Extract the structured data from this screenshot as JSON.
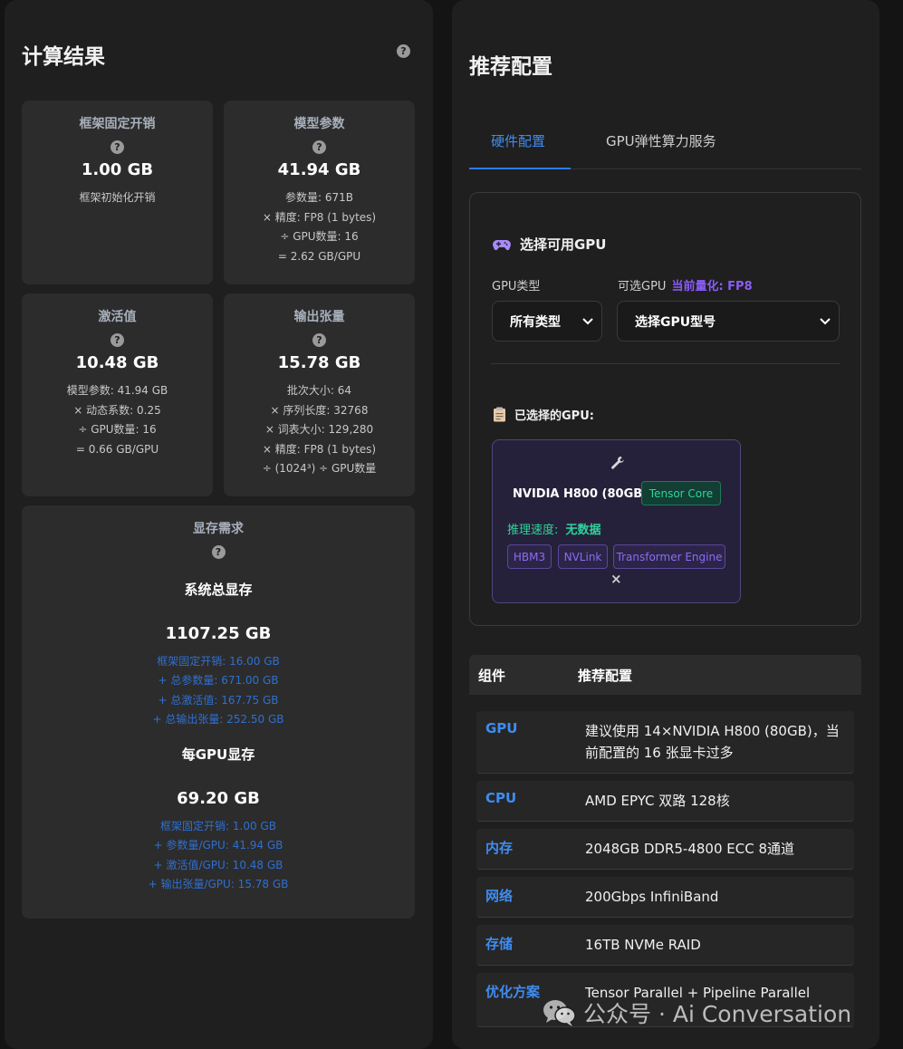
{
  "left": {
    "title": "计算结果",
    "help_icon": "question-circle-icon",
    "cards": {
      "framework": {
        "title": "框架固定开销",
        "value": "1.00 GB",
        "details": [
          "框架初始化开销"
        ]
      },
      "params": {
        "title": "模型参数",
        "value": "41.94 GB",
        "details": [
          "参数量: 671B",
          "× 精度: FP8 (1 bytes)",
          "÷ GPU数量: 16",
          "= 2.62 GB/GPU"
        ]
      },
      "activation": {
        "title": "激活值",
        "value": "10.48 GB",
        "details": [
          "模型参数: 41.94 GB",
          "× 动态系数: 0.25",
          "÷ GPU数量: 16",
          "= 0.66 GB/GPU"
        ]
      },
      "output": {
        "title": "输出张量",
        "value": "15.78 GB",
        "details": [
          "批次大小: 64",
          "× 序列长度: 32768",
          "× 词表大小: 129,280",
          "× 精度: FP8 (1 bytes)",
          "÷ (1024³) ÷ GPU数量"
        ]
      }
    },
    "memory": {
      "title": "显存需求",
      "system_label": "系统总显存",
      "system_total": "1107.25 GB",
      "system_breakdown": [
        "框架固定开销: 16.00 GB",
        "+ 总参数量: 671.00 GB",
        "+ 总激活值: 167.75 GB",
        "+ 总输出张量: 252.50 GB"
      ],
      "per_gpu_label": "每GPU显存",
      "per_gpu_total": "69.20 GB",
      "per_gpu_breakdown": [
        "框架固定开销: 1.00 GB",
        "+ 参数量/GPU: 41.94 GB",
        "+ 激活值/GPU: 10.48 GB",
        "+ 输出张量/GPU: 15.78 GB"
      ]
    }
  },
  "right": {
    "title": "推荐配置",
    "tabs": [
      {
        "label": "硬件配置",
        "active": true
      },
      {
        "label": "GPU弹性算力服务",
        "active": false
      }
    ],
    "select_gpu": {
      "title": "选择可用GPU",
      "title_icon": "gamepad-icon",
      "gpu_type_label": "GPU类型",
      "gpu_type_value": "所有类型",
      "available_label": "可选GPU",
      "quant_label": "当前量化: FP8",
      "available_value": "选择GPU型号"
    },
    "selected": {
      "title": "已选择的GPU:",
      "title_icon": "clipboard-icon",
      "card": {
        "icon": "wrench-icon",
        "name": "NVIDIA H800 (80GB)",
        "tensor_tag": "Tensor Core",
        "speed_label": "推理速度:",
        "speed_value": "无数据",
        "features": [
          "HBM3",
          "NVLink",
          "Transformer Engine"
        ],
        "remove_label": "×"
      }
    },
    "config_table": {
      "headers": [
        "组件",
        "推荐配置"
      ],
      "rows": [
        {
          "key": "GPU",
          "value": "建议使用 14×NVIDIA H800 (80GB)，当前配置的 16 张显卡过多"
        },
        {
          "key": "CPU",
          "value": "AMD EPYC 双路 128核"
        },
        {
          "key": "内存",
          "value": "2048GB DDR5-4800 ECC 8通道"
        },
        {
          "key": "网络",
          "value": "200Gbps InfiniBand"
        },
        {
          "key": "存储",
          "value": "16TB NVMe RAID"
        },
        {
          "key": "优化方案",
          "value": "Tensor Parallel + Pipeline Parallel"
        }
      ]
    }
  },
  "watermark": {
    "icon": "wechat-icon",
    "text": "公众号 · Ai Conversation"
  },
  "colors": {
    "accent_blue": "#3f8cf0",
    "purple": "#8b5cf6",
    "green": "#2fd39a"
  }
}
